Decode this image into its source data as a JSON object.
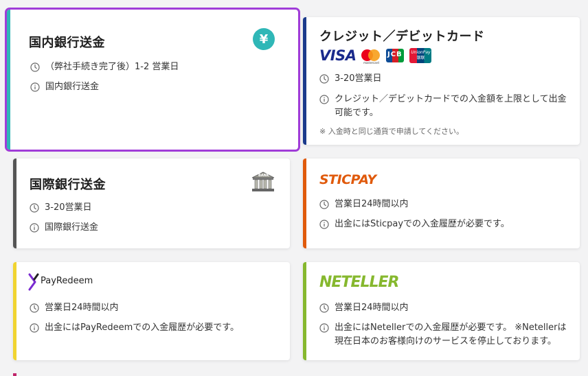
{
  "cards": {
    "domestic": {
      "title": "国内銀行送金",
      "time": "（弊社手続き完了後）1-2 営業日",
      "info": "国内銀行送金",
      "accent": "#2fb7b7"
    },
    "credit": {
      "title": "クレジット／デビットカード",
      "time": "3-20営業日",
      "info": "クレジット／デビットカードでの入金額を上限として出金可能です。",
      "note": "※ 入金時と同じ通貨で申請してください。",
      "accent": "#1b3a8c",
      "logos": {
        "visa": "VISA",
        "mastercard_label": "mastercard",
        "jcb": "JCB",
        "unionpay_top": "UnionPay",
        "unionpay_bottom": "银联"
      }
    },
    "international": {
      "title": "国際銀行送金",
      "time": "3-20営業日",
      "info": "国際銀行送金",
      "accent": "#555555",
      "bank_label": "BANK"
    },
    "sticpay": {
      "logo": "STICPAY",
      "time": "営業日24時間以内",
      "info": "出金にはSticpayでの入金履歴が必要です。",
      "accent": "#e05a0c"
    },
    "payredeem": {
      "logo": "PayRedeem",
      "time": "営業日24時間以内",
      "info": "出金にはPayRedeemでの入金履歴が必要です。",
      "accent": "#f1d430"
    },
    "neteller": {
      "logo": "NETELLER",
      "time": "営業日24時間以内",
      "info": "出金にはNetellerでの入金履歴が必要です。 ※Netellerは現在日本のお客様向けのサービスを停止しております。",
      "accent": "#86b82e"
    }
  },
  "icons": {
    "time": "clock-icon",
    "info": "info-icon",
    "yen": "yen-icon",
    "bank": "bank-icon"
  },
  "yen_symbol": "¥",
  "selection_color": "#a03cd8"
}
